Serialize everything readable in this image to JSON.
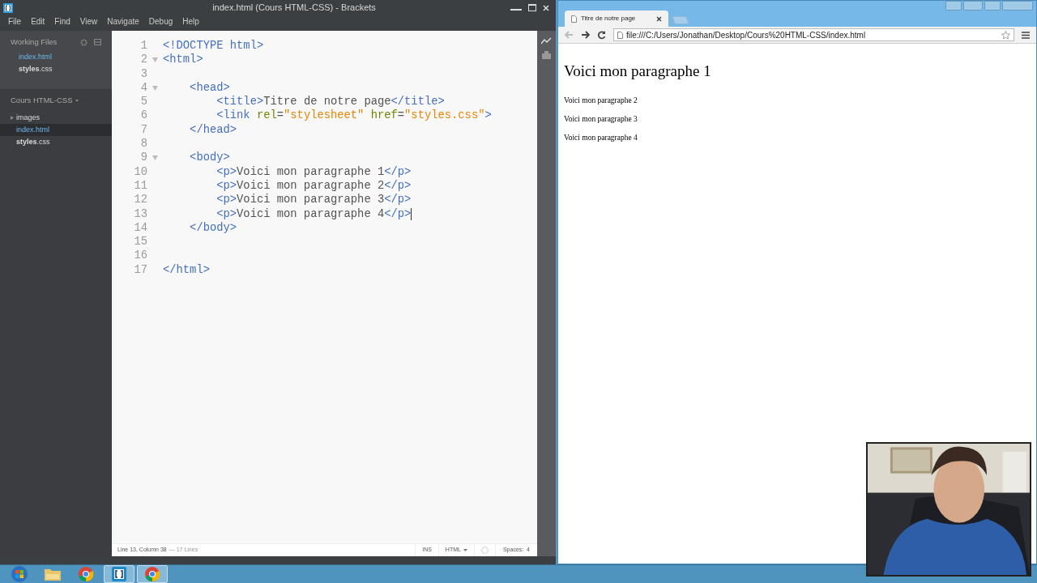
{
  "editor_window": {
    "title": "index.html (Cours HTML-CSS) - Brackets",
    "menu": [
      "File",
      "Edit",
      "Find",
      "View",
      "Navigate",
      "Debug",
      "Help"
    ],
    "working_files": {
      "label": "Working Files",
      "files": [
        {
          "name": "index.html",
          "selected": true
        },
        {
          "name": "**styles**.css",
          "selected": false
        }
      ]
    },
    "project": {
      "label": "Cours HTML-CSS",
      "items": [
        {
          "kind": "folder",
          "name": "images",
          "expanded": false,
          "selected": false
        },
        {
          "kind": "file",
          "name": "index.html",
          "selected": true
        },
        {
          "kind": "file",
          "name": "**styles**.css",
          "selected": false
        }
      ]
    },
    "lines": [
      {
        "number": "1",
        "fold": false,
        "cursor": false,
        "tokens": [
          {
            "kind": "tag",
            "text": "<!DOCTYPE html>"
          }
        ]
      },
      {
        "number": "2",
        "fold": true,
        "cursor": false,
        "tokens": [
          {
            "kind": "tag",
            "text": "<html>"
          }
        ]
      },
      {
        "number": "3",
        "fold": false,
        "cursor": false
      },
      {
        "number": "4",
        "fold": true,
        "cursor": false,
        "tokens": [
          {
            "kind": "tag",
            "text": "    <head>"
          }
        ]
      },
      {
        "number": "5",
        "fold": false,
        "cursor": false,
        "tokens": [
          {
            "kind": "tag",
            "text": "        <title>"
          },
          {
            "kind": "text",
            "text": "Titre de notre page"
          },
          {
            "kind": "tag",
            "text": "</title>"
          }
        ]
      },
      {
        "number": "6",
        "fold": false,
        "cursor": false,
        "tokens": [
          {
            "kind": "tag",
            "text": "        <link"
          },
          {
            "kind": "attr",
            "text": " rel"
          },
          {
            "kind": "text",
            "text": "="
          },
          {
            "kind": "string",
            "text": "\"stylesheet\""
          },
          {
            "kind": "attr",
            "text": " href"
          },
          {
            "kind": "text",
            "text": "="
          },
          {
            "kind": "string",
            "text": "\"styles.css\""
          },
          {
            "kind": "tag",
            "text": ">"
          }
        ]
      },
      {
        "number": "7",
        "fold": false,
        "cursor": false,
        "tokens": [
          {
            "kind": "tag",
            "text": "    </head>"
          }
        ]
      },
      {
        "number": "8",
        "fold": false,
        "cursor": false
      },
      {
        "number": "9",
        "fold": true,
        "cursor": false,
        "tokens": [
          {
            "kind": "tag",
            "text": "    <body>"
          }
        ]
      },
      {
        "number": "10",
        "fold": false,
        "cursor": false,
        "tokens": [
          {
            "kind": "tag",
            "text": "        <p>"
          },
          {
            "kind": "text",
            "text": "Voici mon paragraphe 1"
          },
          {
            "kind": "tag",
            "text": "</p>"
          }
        ]
      },
      {
        "number": "11",
        "fold": false,
        "cursor": false,
        "tokens": [
          {
            "kind": "tag",
            "text": "        <p>"
          },
          {
            "kind": "text",
            "text": "Voici mon paragraphe 2"
          },
          {
            "kind": "tag",
            "text": "</p>"
          }
        ]
      },
      {
        "number": "12",
        "fold": false,
        "cursor": false,
        "tokens": [
          {
            "kind": "tag",
            "text": "        <p>"
          },
          {
            "kind": "text",
            "text": "Voici mon paragraphe 3"
          },
          {
            "kind": "tag",
            "text": "</p>"
          }
        ]
      },
      {
        "number": "13",
        "fold": false,
        "cursor": true,
        "tokens": [
          {
            "kind": "tag",
            "text": "        <p>"
          },
          {
            "kind": "text",
            "text": "Voici mon paragraphe 4"
          },
          {
            "kind": "tag",
            "text": "</p>"
          }
        ]
      },
      {
        "number": "14",
        "fold": false,
        "cursor": false,
        "tokens": [
          {
            "kind": "tag",
            "text": "    </body>"
          }
        ]
      },
      {
        "number": "15",
        "fold": false,
        "cursor": false
      },
      {
        "number": "16",
        "fold": false,
        "cursor": false
      },
      {
        "number": "17",
        "fold": false,
        "cursor": false,
        "tokens": [
          {
            "kind": "tag",
            "text": "</html>"
          }
        ]
      }
    ],
    "status_bar": {
      "position": "Line 13, Column 38",
      "line_count": "— 17 Lines",
      "mode": "INS",
      "language": "HTML",
      "spaces": "Spaces:  4"
    }
  },
  "browser": {
    "tab": "Titre de notre page",
    "url": "file:///C:/Users/Jonathan/Desktop/Cours%20HTML-CSS/index.html",
    "page": {
      "heading": "Voici mon paragraphe 1",
      "paragraphs": [
        "Voici mon paragraphe 2",
        "Voici mon paragraphe 3",
        "Voici mon paragraphe 4"
      ]
    }
  },
  "taskbar": {
    "items": [
      {
        "kind": "start",
        "running": false
      },
      {
        "kind": "explorer",
        "running": false
      },
      {
        "kind": "chrome",
        "running": false
      },
      {
        "kind": "brackets",
        "running": true
      },
      {
        "kind": "chrome",
        "running": true
      }
    ]
  }
}
